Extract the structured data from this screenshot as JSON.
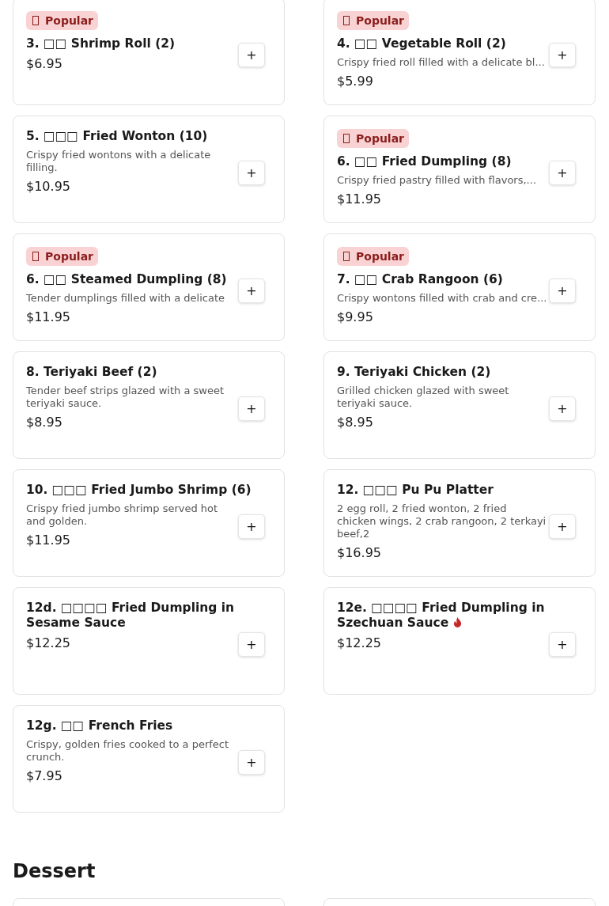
{
  "items": [
    {
      "title": "3. □□ Shrimp Roll (2)",
      "badge": "Popular",
      "price": "$6.95"
    },
    {
      "title": "4. □□ Vegetable Roll (2)",
      "badge": "Popular",
      "description": "Crispy fried roll filled with a delicate bl...",
      "price": "$5.99"
    },
    {
      "title": "5. □□□ Fried Wonton (10)",
      "description": "Crispy fried wontons with a delicate filling.",
      "price": "$10.95"
    },
    {
      "title": "6. □□ Fried Dumpling (8)",
      "badge": "Popular",
      "description": "Crispy fried pastry filled with flavors,...",
      "price": "$11.95"
    },
    {
      "title": "6. □□ Steamed Dumpling (8)",
      "badge": "Popular",
      "description": "Tender dumplings filled with a delicate",
      "price": "$11.95"
    },
    {
      "title": "7. □□ Crab Rangoon (6)",
      "badge": "Popular",
      "description": "Crispy wontons filled with crab and cre...",
      "price": "$9.95"
    },
    {
      "title": "8. Teriyaki Beef (2)",
      "description": "Tender beef strips glazed with a sweet teriyaki sauce.",
      "price": "$8.95"
    },
    {
      "title": "9. Teriyaki Chicken (2)",
      "description": "Grilled chicken glazed with sweet teriyaki sauce.",
      "price": "$8.95"
    },
    {
      "title": "10. □□□ Fried Jumbo Shrimp (6)",
      "description": "Crispy fried jumbo shrimp served hot and golden.",
      "price": "$11.95"
    },
    {
      "title": "12. □□□ Pu Pu Platter",
      "description": "2 egg roll, 2 fried wonton, 2 fried chicken wings, 2 crab rangoon, 2 terkayi beef,2",
      "price": "$16.95"
    },
    {
      "title": "12d. □□□□ Fried Dumpling in Sesame Sauce",
      "price": "$12.25"
    },
    {
      "title": "12e. □□□□ Fried Dumpling in Szechuan Sauce",
      "spicy": true,
      "price": "$12.25"
    },
    {
      "title": "12g. □□ French Fries",
      "description": "Crispy, golden fries cooked to a perfect crunch.",
      "price": "$7.95"
    }
  ],
  "add_button": "+",
  "next_section": {
    "title": "Dessert"
  }
}
